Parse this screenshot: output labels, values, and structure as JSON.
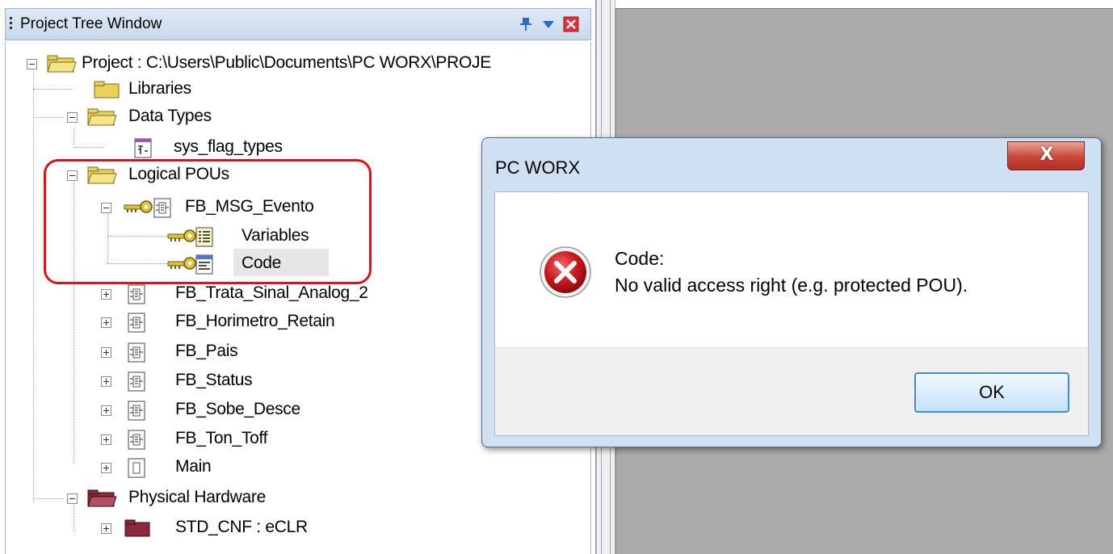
{
  "panel": {
    "title": "Project Tree Window",
    "pin_icon": "pin-icon",
    "menu_icon": "dropdown-icon",
    "close_icon": "close-icon"
  },
  "tree": {
    "project": "Project : C:\\Users\\Public\\Documents\\PC WORX\\PROJE",
    "libraries": "Libraries",
    "data_types": "Data Types",
    "sys_flag_types": "sys_flag_types",
    "logical_pous": "Logical POUs",
    "fb_msg_evento": "FB_MSG_Evento",
    "variables": "Variables",
    "code": "Code",
    "fb_trata": "FB_Trata_Sinal_Analog_2",
    "fb_horimetro": "FB_Horimetro_Retain",
    "fb_pais": "FB_Pais",
    "fb_status": "FB_Status",
    "fb_sobe": "FB_Sobe_Desce",
    "fb_ton": "FB_Ton_Toff",
    "main": "Main",
    "physical_hardware": "Physical Hardware",
    "std_cnf": "STD_CNF : eCLR"
  },
  "dialog": {
    "title": "PC WORX",
    "close_label": "X",
    "message_line1": "Code:",
    "message_line2": "No valid access right (e.g. protected POU).",
    "ok_label": "OK"
  },
  "colors": {
    "highlight": "#e01018",
    "folder": "#e8d25a",
    "hardware_folder": "#8a2a3a",
    "error_red": "#c8181c"
  }
}
